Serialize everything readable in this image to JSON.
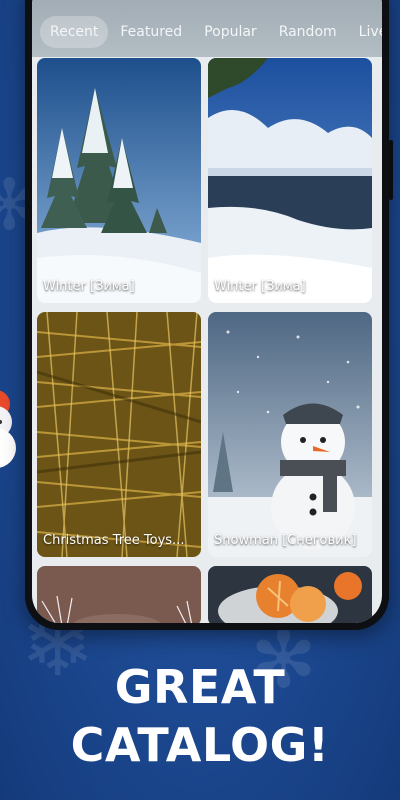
{
  "tabs": [
    {
      "label": "Recent",
      "active": true
    },
    {
      "label": "Featured",
      "active": false
    },
    {
      "label": "Popular",
      "active": false
    },
    {
      "label": "Random",
      "active": false
    },
    {
      "label": "Live W",
      "active": false
    }
  ],
  "cards": [
    {
      "title": "Winter [Зима]",
      "image": "snowy-fir-trees"
    },
    {
      "title": "Winter [Зима]",
      "image": "winter-river"
    },
    {
      "title": "Christmas Tree Toys...",
      "image": "gold-tinsel"
    },
    {
      "title": "Snowman [Снеговик]",
      "image": "snowman"
    },
    {
      "title": "",
      "image": "candle-sparks"
    },
    {
      "title": "",
      "image": "tangerines"
    }
  ],
  "headline": {
    "line1": "GREAT",
    "line2": "CATALOG!"
  },
  "colors": {
    "background": "#1f4d98",
    "tabbar": "#a9b4bb",
    "headline": "#ffffff"
  }
}
